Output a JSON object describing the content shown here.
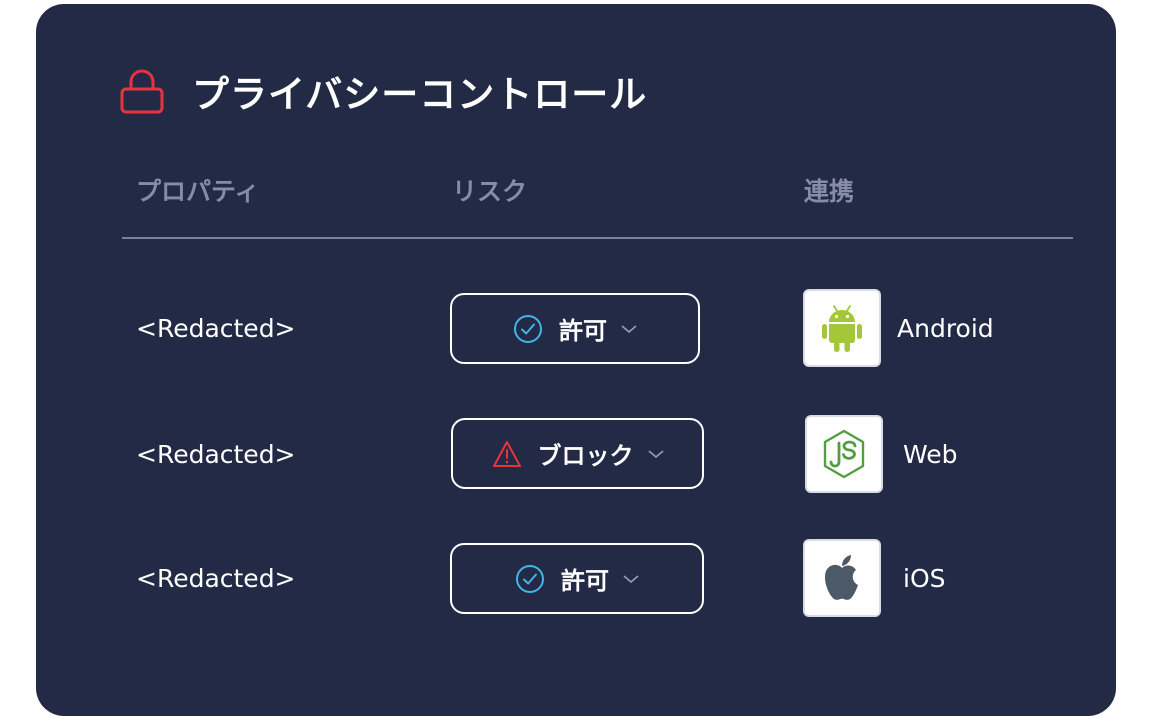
{
  "title": "プライバシーコントロール",
  "columns": {
    "property": "プロパティ",
    "risk": "リスク",
    "integration": "連携"
  },
  "rows": [
    {
      "property": "<Redacted>",
      "risk": {
        "label": "許可",
        "status": "allow",
        "icon": "check-circle-icon"
      },
      "platform": {
        "name": "Android",
        "icon": "android-icon"
      }
    },
    {
      "property": "<Redacted>",
      "risk": {
        "label": "ブロック",
        "status": "block",
        "icon": "warning-triangle-icon"
      },
      "platform": {
        "name": "Web",
        "icon": "nodejs-icon"
      }
    },
    {
      "property": "<Redacted>",
      "risk": {
        "label": "許可",
        "status": "allow",
        "icon": "check-circle-icon"
      },
      "platform": {
        "name": "iOS",
        "icon": "apple-icon"
      }
    }
  ],
  "colors": {
    "background": "#232a45",
    "lock_icon": "#e8323f",
    "check_icon": "#3fb6e8",
    "warning_icon": "#e8323f",
    "header_text": "#858ca4",
    "android_green": "#a4c639",
    "nodejs_green": "#539e43",
    "apple_gray": "#4b5a66"
  }
}
